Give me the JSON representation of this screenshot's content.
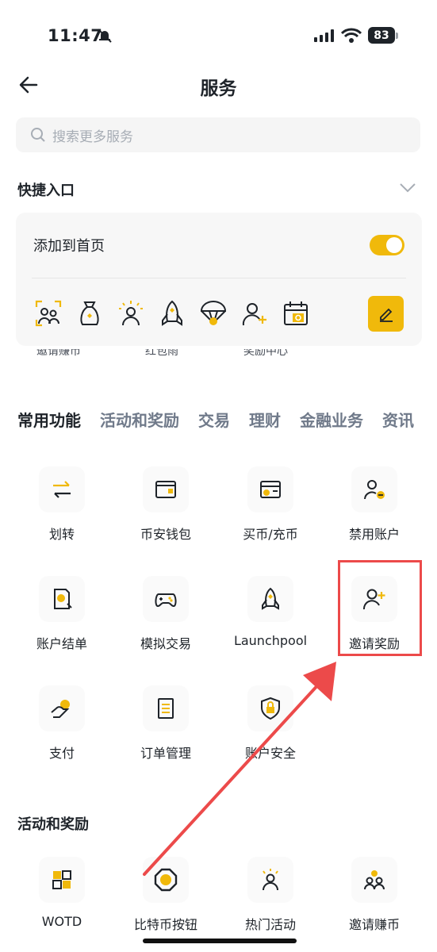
{
  "status_bar": {
    "time": "11:47",
    "battery": "83"
  },
  "header": {
    "title": "服务"
  },
  "search": {
    "placeholder": "搜索更多服务"
  },
  "quick_entry": {
    "title": "快捷入口",
    "add_to_home_label": "添加到首页",
    "toggle_on": true,
    "icons": [
      "invite-earn-icon",
      "red-packet-icon",
      "reward-center-icon",
      "launchpool-icon",
      "parachute-icon",
      "invite-user-icon",
      "calendar-icon"
    ],
    "partial_labels": [
      "邀请赚币",
      "红包雨",
      "奖励中心"
    ]
  },
  "tabs": [
    "常用功能",
    "活动和奖励",
    "交易",
    "理财",
    "金融业务",
    "资讯"
  ],
  "common_functions": [
    {
      "label": "划转",
      "icon": "transfer-icon"
    },
    {
      "label": "币安钱包",
      "icon": "wallet-icon"
    },
    {
      "label": "买币/充币",
      "icon": "buy-crypto-icon"
    },
    {
      "label": "禁用账户",
      "icon": "disable-account-icon"
    },
    {
      "label": "账户结单",
      "icon": "statement-icon"
    },
    {
      "label": "模拟交易",
      "icon": "gamepad-icon"
    },
    {
      "label": "Launchpool",
      "icon": "rocket-icon"
    },
    {
      "label": "邀请奖励",
      "icon": "invite-reward-icon"
    },
    {
      "label": "支付",
      "icon": "pay-icon"
    },
    {
      "label": "订单管理",
      "icon": "order-icon"
    },
    {
      "label": "账户安全",
      "icon": "shield-lock-icon"
    }
  ],
  "activities": {
    "title": "活动和奖励",
    "items": [
      {
        "label": "WOTD",
        "icon": "wotd-icon"
      },
      {
        "label": "比特币按钮",
        "icon": "bitcoin-button-icon"
      },
      {
        "label": "热门活动",
        "icon": "hot-activity-icon"
      },
      {
        "label": "邀请赚币",
        "icon": "invite-earn-icon"
      }
    ]
  },
  "colors": {
    "accent": "#f0b90b",
    "annotation": "#ec4a4a",
    "text": "#1e2329",
    "muted": "#707a8a"
  }
}
